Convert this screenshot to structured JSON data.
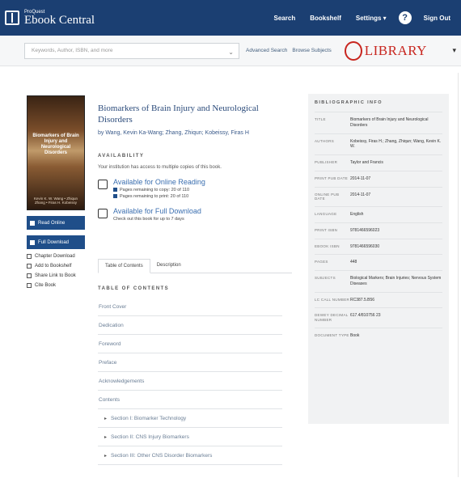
{
  "header": {
    "brand_top": "ProQuest",
    "brand_main": "Ebook Central",
    "links": [
      {
        "label": "Search"
      },
      {
        "label": "Bookshelf"
      },
      {
        "label": "Settings ▾"
      }
    ],
    "sign_out": "Sign Out",
    "help": "?"
  },
  "search": {
    "placeholder": "Keywords, Author, ISBN, and more",
    "advanced": "Advanced Search",
    "browse": "Browse Subjects"
  },
  "library": {
    "label": "LIBRARY",
    "menu": "▾"
  },
  "book": {
    "title": "Biomarkers of Brain Injury and Neurological Disorders",
    "authors": "by Wang, Kevin Ka-Wang; Zhang, Zhiqun; Kobeissy, Firas H",
    "cover_title": "Biomarkers of Brain Injury and Neurological Disorders",
    "cover_authors": "Kevin K. W. Wang • Zhiqun Zhang • Firas H. Kobeissy"
  },
  "sidebar": {
    "buttons": [
      {
        "label": "Read Online"
      },
      {
        "label": "Full Download"
      }
    ],
    "links": [
      {
        "label": "Chapter Download"
      },
      {
        "label": "Add to Bookshelf"
      },
      {
        "label": "Share Link to Book"
      },
      {
        "label": "Cite Book"
      }
    ]
  },
  "availability": {
    "heading": "AVAILABILITY",
    "note": "Your institution has access to multiple copies of this book.",
    "online": {
      "label": "Available for Online Reading",
      "sub1": "Pages remaining to copy: 20 of 110",
      "sub2": "Pages remaining to print: 20 of 110"
    },
    "download": {
      "label": "Available for Full Download",
      "sub": "Check out this book for up to 7 days"
    }
  },
  "tabs": [
    {
      "label": "Table of Contents"
    },
    {
      "label": "Description"
    }
  ],
  "toc": {
    "heading": "TABLE OF CONTENTS",
    "items": [
      {
        "label": "Front Cover"
      },
      {
        "label": "Dedication"
      },
      {
        "label": "Foreword"
      },
      {
        "label": "Preface"
      },
      {
        "label": "Acknowledgements"
      },
      {
        "label": "Contents"
      },
      {
        "label": "Section I: Biomarker Technology"
      },
      {
        "label": "Section II: CNS Injury Biomarkers"
      },
      {
        "label": "Section III: Other CNS Disorder Biomarkers"
      }
    ]
  },
  "bibliographic": {
    "heading": "BIBLIOGRAPHIC INFO",
    "rows": [
      {
        "key": "Title",
        "value": "Biomarkers of Brain Injury and Neurological Disorders"
      },
      {
        "key": "Authors",
        "value": "Kobeissy, Firas H.; Zhang, Zhiqun; Wang, Kevin K. W."
      },
      {
        "key": "Publisher",
        "value": "Taylor and Francis"
      },
      {
        "key": "Print Pub Date",
        "value": "2014-11-07"
      },
      {
        "key": "Online Pub Date",
        "value": "2014-11-07"
      },
      {
        "key": "Language",
        "value": "English"
      },
      {
        "key": "Print ISBN",
        "value": "9781466596023"
      },
      {
        "key": "eBook ISBN",
        "value": "9781466596030"
      },
      {
        "key": "Pages",
        "value": "448"
      },
      {
        "key": "Subjects",
        "value": "Biological Markers; Brain Injuries; Nervous System Diseases"
      },
      {
        "key": "LC Call Number",
        "value": "RC387.5.B56"
      },
      {
        "key": "Dewey Decimal Number",
        "value": "617.4/810756 23"
      },
      {
        "key": "Document Type",
        "value": "Book"
      }
    ]
  }
}
